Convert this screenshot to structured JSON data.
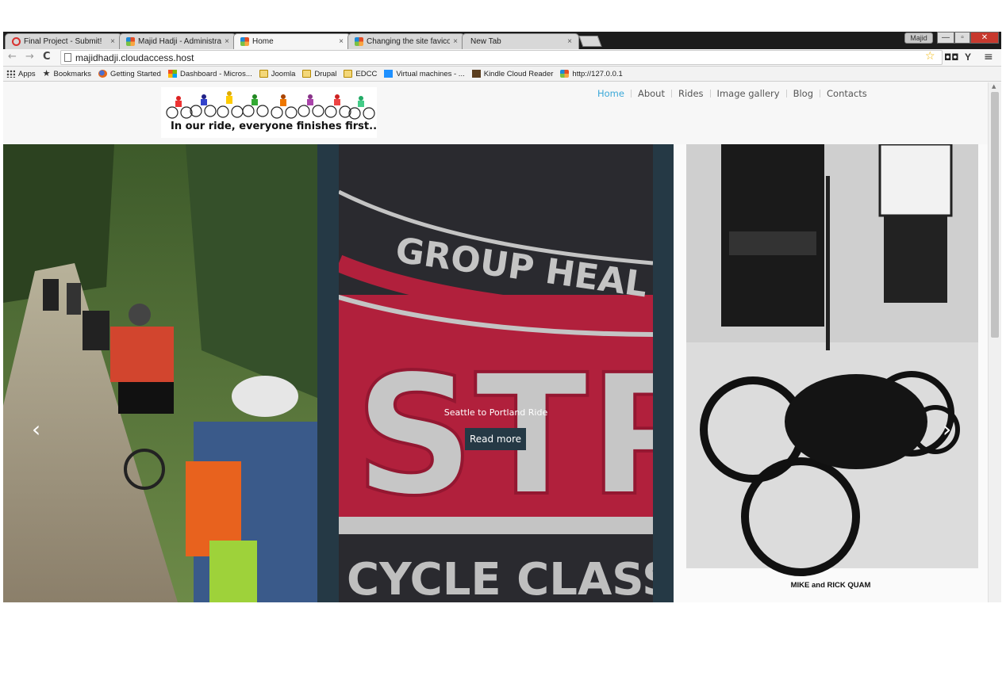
{
  "browser": {
    "tabs": [
      {
        "title": "Final Project - Submit!",
        "icon": "ring-icon"
      },
      {
        "title": "Majid Hadji - Administrati",
        "icon": "joomla-icon"
      },
      {
        "title": "Home",
        "icon": "joomla-icon",
        "active": true
      },
      {
        "title": "Changing the site favicon",
        "icon": "joomla-icon"
      },
      {
        "title": "New Tab",
        "icon": ""
      }
    ],
    "tab_close": "×",
    "user_name": "Majid",
    "window_buttons": {
      "minimize": "—",
      "maximize": "▫",
      "close": "✕"
    },
    "nav": {
      "back": "←",
      "forward": "→",
      "reload": "C"
    },
    "url": "majidhadji.cloudaccess.host",
    "toolbar_icons": {
      "star": "☆",
      "mask": "◘◘",
      "y": "Y",
      "menu": "≡"
    },
    "bookmarks": [
      {
        "label": "Apps",
        "icon": "apps-icon"
      },
      {
        "label": "Bookmarks",
        "icon": "star-icon"
      },
      {
        "label": "Getting Started",
        "icon": "firefox-icon"
      },
      {
        "label": "Dashboard - Micros...",
        "icon": "microsoft-icon"
      },
      {
        "label": "Joomla",
        "icon": "folder-icon"
      },
      {
        "label": "Drupal",
        "icon": "folder-icon"
      },
      {
        "label": "EDCC",
        "icon": "folder-icon"
      },
      {
        "label": "Virtual machines - ...",
        "icon": "windows-icon"
      },
      {
        "label": "Kindle Cloud Reader",
        "icon": "kindle-icon"
      },
      {
        "label": "http://127.0.0.1",
        "icon": "joomla-icon"
      }
    ]
  },
  "site": {
    "logo_tagline": "In our ride, everyone finishes first...",
    "nav": [
      "Home",
      "About",
      "Rides",
      "Image gallery",
      "Blog",
      "Contacts"
    ],
    "active_nav": "Home"
  },
  "slider": {
    "caption": "Seattle to Portland Ride",
    "read_more": "Read more",
    "prev": "‹",
    "next": "›",
    "slide_2_lettering": [
      "GROUP HEAL",
      "STP",
      "CYCLE CLASS"
    ],
    "slide_3_caption": "MIKE and RICK QUAM"
  },
  "colors": {
    "accent": "#3aa8d8",
    "slider_bg": "#253945",
    "button_bg": "#253945"
  }
}
